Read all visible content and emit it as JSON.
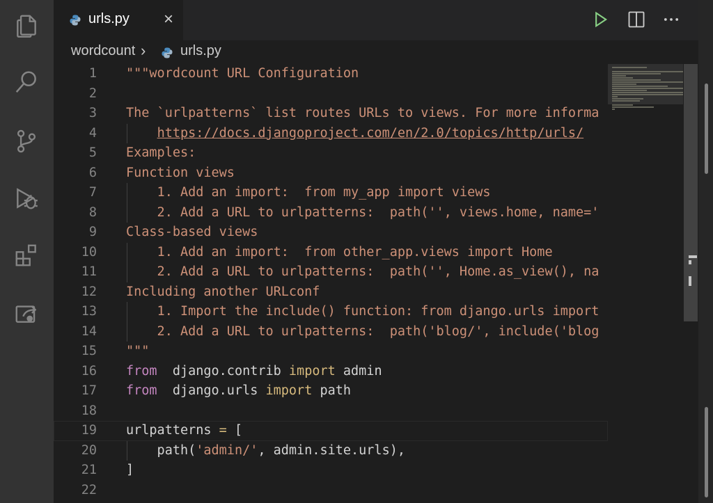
{
  "activity_bar": {
    "icons": [
      "explorer-icon",
      "search-icon",
      "source-control-icon",
      "run-debug-icon",
      "extensions-icon",
      "remote-explorer-icon"
    ]
  },
  "tab": {
    "label": "urls.py",
    "close_glyph": "×"
  },
  "tab_actions": [
    "run-icon",
    "split-editor-icon",
    "more-actions-icon"
  ],
  "breadcrumb": {
    "folder": "wordcount",
    "chevron": "›",
    "file": "urls.py"
  },
  "code": {
    "lines": [
      {
        "n": "1",
        "text": "\"\"\"wordcount URL Configuration"
      },
      {
        "n": "2",
        "text": ""
      },
      {
        "n": "3",
        "text": "The `urlpatterns` list routes URLs to views. For more informa"
      },
      {
        "n": "4",
        "text": "    https://docs.djangoproject.com/en/2.0/topics/http/urls/"
      },
      {
        "n": "5",
        "text": "Examples:"
      },
      {
        "n": "6",
        "text": "Function views"
      },
      {
        "n": "7",
        "text": "    1. Add an import:  from my_app import views"
      },
      {
        "n": "8",
        "text": "    2. Add a URL to urlpatterns:  path('', views.home, name='"
      },
      {
        "n": "9",
        "text": "Class-based views"
      },
      {
        "n": "10",
        "text": "    1. Add an import:  from other_app.views import Home"
      },
      {
        "n": "11",
        "text": "    2. Add a URL to urlpatterns:  path('', Home.as_view(), na"
      },
      {
        "n": "12",
        "text": "Including another URLconf"
      },
      {
        "n": "13",
        "text": "    1. Import the include() function: from django.urls import"
      },
      {
        "n": "14",
        "text": "    2. Add a URL to urlpatterns:  path('blog/', include('blog"
      },
      {
        "n": "15",
        "text": "\"\"\""
      },
      {
        "n": "16",
        "parts": [
          [
            "k2",
            "from"
          ],
          [
            "",
            "  django.contrib "
          ],
          [
            "k",
            "import"
          ],
          [
            "",
            " admin"
          ]
        ]
      },
      {
        "n": "17",
        "parts": [
          [
            "k2",
            "from"
          ],
          [
            "",
            "  django.urls "
          ],
          [
            "k",
            "import"
          ],
          [
            "",
            " path"
          ]
        ]
      },
      {
        "n": "18",
        "text": ""
      },
      {
        "n": "19",
        "parts": [
          [
            "",
            "urlpatterns "
          ],
          [
            "k",
            "="
          ],
          [
            "",
            " ["
          ]
        ]
      },
      {
        "n": "20",
        "parts": [
          [
            "",
            "    path("
          ],
          [
            "s",
            "'admin/'"
          ],
          [
            "",
            ", admin.site.urls),"
          ]
        ]
      },
      {
        "n": "21",
        "parts": [
          [
            "",
            "]"
          ]
        ]
      },
      {
        "n": "22",
        "text": ""
      }
    ]
  },
  "colors": {
    "background": "#1e1e1e",
    "activity_bar": "#333333",
    "tab_bar": "#252526",
    "string": "#ce9178",
    "keyword": "#d7ba7d",
    "line_number": "#858585",
    "run_icon": "#89d185"
  }
}
